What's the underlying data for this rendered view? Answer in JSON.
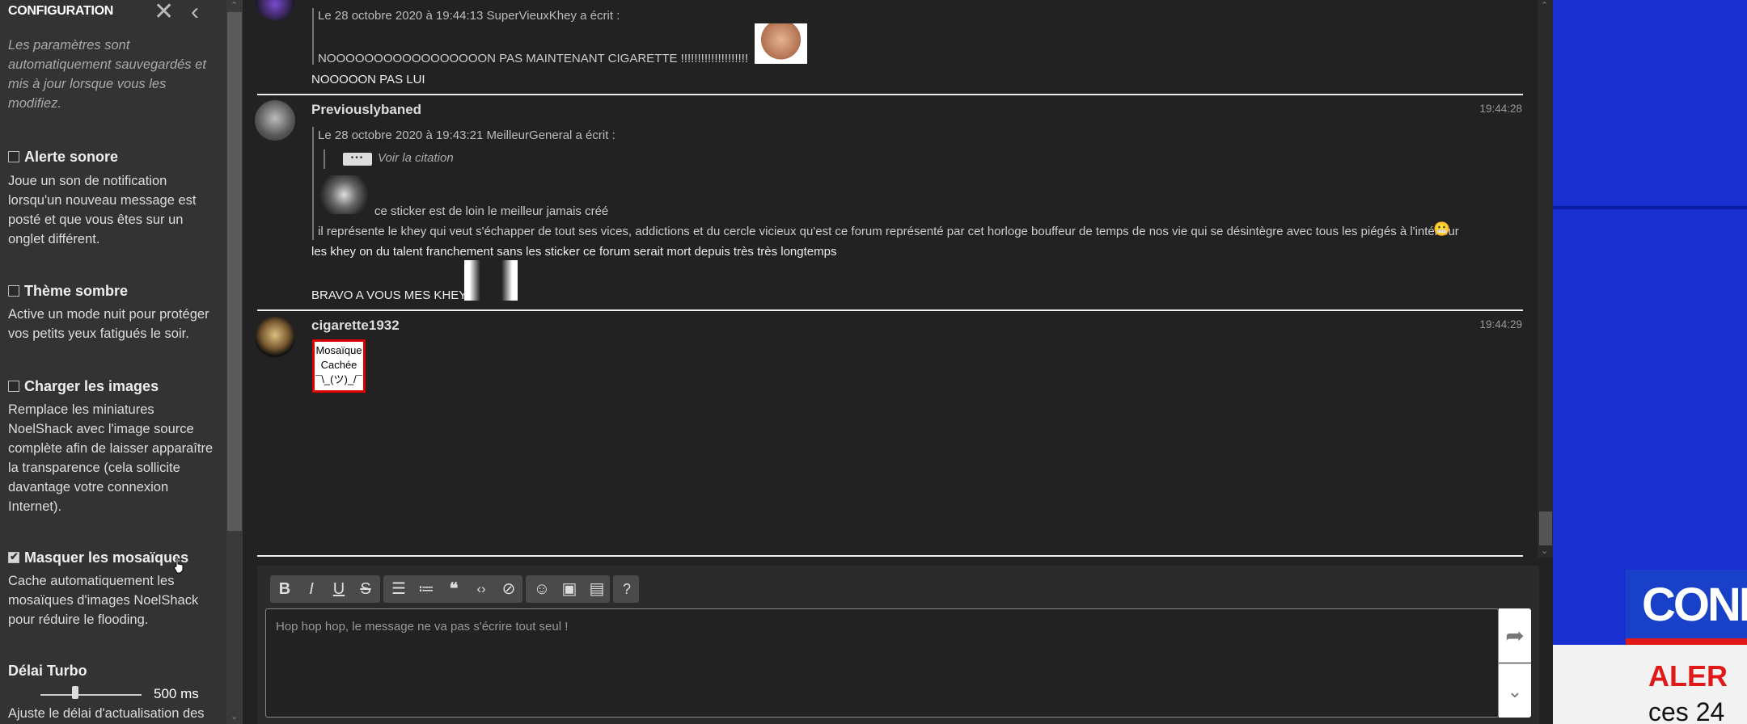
{
  "sidebar": {
    "title": "CONFIGURATION",
    "intro": "Les paramètres sont automatiquement sauvegardés et mis à jour lorsque vous les modifiez.",
    "options": [
      {
        "title": "Alerte sonore",
        "checked": false,
        "description": "Joue un son de notification lorsqu'un nouveau message est posté et que vous êtes sur un onglet différent."
      },
      {
        "title": "Thème sombre",
        "checked": false,
        "description": "Active un mode nuit pour protéger vos petits yeux fatigués le soir."
      },
      {
        "title": "Charger les images",
        "checked": false,
        "description": "Remplace les miniatures NoelShack avec l'image source complète afin de laisser apparaître la transparence (cela sollicite davantage votre connexion Internet)."
      },
      {
        "title": "Masquer les mosaïques",
        "checked": true,
        "description": "Cache automatiquement les mosaïques d'images NoelShack pour réduire le flooding."
      }
    ],
    "turbo": {
      "title": "Délai Turbo",
      "value": "500 ms",
      "description": "Ajuste le délai d'actualisation des"
    }
  },
  "messages": [
    {
      "quote_header": "Le 28 octobre 2020 à 19:44:13 SuperVieuxKhey a écrit :",
      "quote_text": "NOOOOOOOOOOOOOOOOON PAS MAINTENANT CIGARETTE !!!!!!!!!!!!!!!!!!!!",
      "text": "NOOOOON PAS LUI"
    },
    {
      "author": "Previouslybaned",
      "time": "19:44:28",
      "quote_header": "Le 28 octobre 2020 à 19:43:21 MeilleurGeneral a écrit :",
      "nested_quote_label": "Voir la citation",
      "quote_line1": "ce sticker est de loin le meilleur jamais créé",
      "quote_line2": "il représente le khey qui veut s'échapper de tout ses vices, addictions et du cercle vicieux qu'est ce forum représenté par cet horloge bouffeur de temps de nos vie qui se désintègre avec tous les piégés à l'intérieur",
      "text1": "les khey on du talent franchement sans les sticker ce forum serait mort depuis très très longtemps",
      "text2": "BRAVO A VOUS MES KHEY"
    },
    {
      "author": "cigarette1932",
      "time": "19:44:29",
      "mosaic_line1": "Mosaïque",
      "mosaic_line2": "Cachée",
      "mosaic_line3": "¯\\_(ツ)_/¯"
    }
  ],
  "editor": {
    "placeholder": "Hop hop hop, le message ne va pas s'écrire tout seul !",
    "toolbar": [
      "bold-icon",
      "italic-icon",
      "underline-icon",
      "strikethrough-icon",
      "bullet-list-icon",
      "numbered-list-icon",
      "quote-icon",
      "code-icon",
      "spoiler-icon",
      "emoji-icon",
      "image-icon",
      "video-icon",
      "help-icon"
    ]
  },
  "video": {
    "banner_text": "CONI",
    "alert_text": "ALER",
    "sub_text": "ces 24"
  },
  "colors": {
    "accent_red": "#dd0000",
    "video_blue": "#1a2fd0"
  }
}
